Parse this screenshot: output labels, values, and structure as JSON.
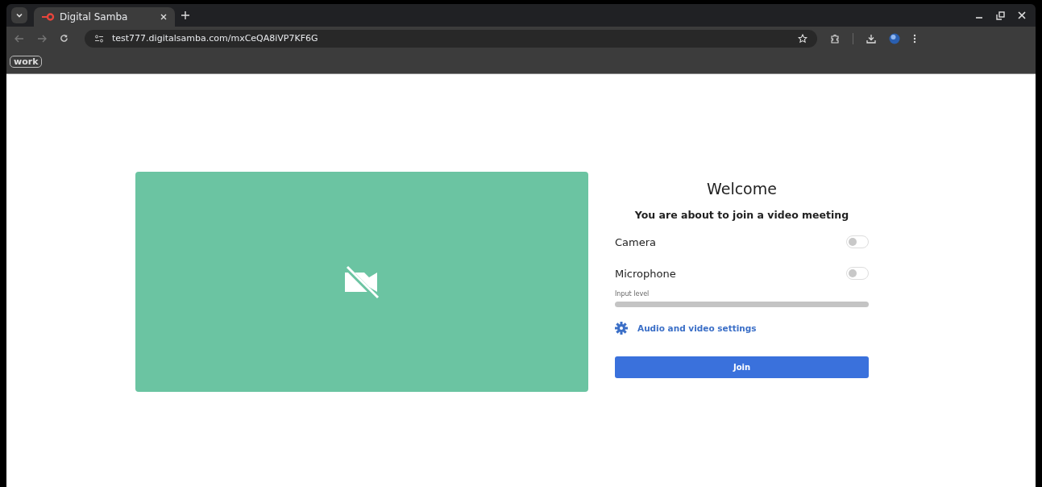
{
  "browser": {
    "tabs": [
      {
        "title": "Digital Samba",
        "selected": true
      }
    ],
    "address": "test777.digitalsamba.com/mxCeQA8iVP7KF6G",
    "bookmarks": [
      "work"
    ]
  },
  "prejoin": {
    "title": "Welcome",
    "subtitle": "You are about to join a video meeting",
    "toggles": [
      {
        "label": "Camera",
        "on": false
      },
      {
        "label": "Microphone",
        "on": false
      }
    ],
    "meter": {
      "label": "Input level",
      "level": 0
    },
    "settings_link": "Audio and video settings",
    "join_button": "Join"
  }
}
